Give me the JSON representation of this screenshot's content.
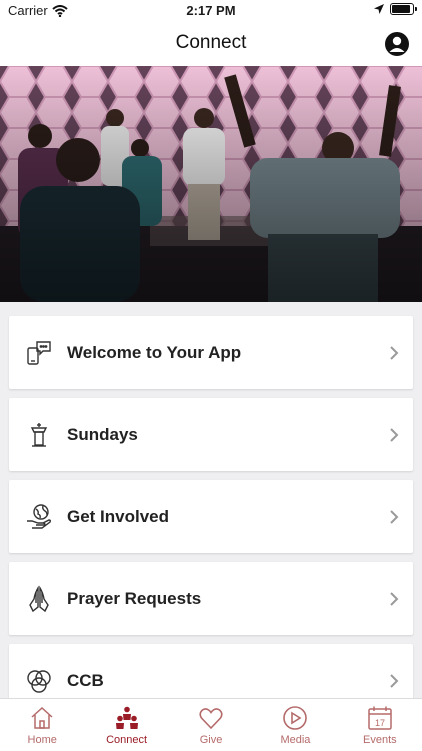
{
  "status_bar": {
    "carrier": "Carrier",
    "time": "2:17 PM"
  },
  "header": {
    "title": "Connect"
  },
  "menu": [
    {
      "label": "Welcome to Your App",
      "icon": "phone-chat-icon"
    },
    {
      "label": "Sundays",
      "icon": "pulpit-icon"
    },
    {
      "label": "Get Involved",
      "icon": "hand-globe-icon"
    },
    {
      "label": "Prayer Requests",
      "icon": "praying-hands-icon"
    },
    {
      "label": "CCB",
      "icon": "overlapping-circles-icon"
    }
  ],
  "tabs": [
    {
      "label": "Home",
      "icon": "home-icon",
      "active": false
    },
    {
      "label": "Connect",
      "icon": "people-icon",
      "active": true
    },
    {
      "label": "Give",
      "icon": "heart-icon",
      "active": false
    },
    {
      "label": "Media",
      "icon": "play-icon",
      "active": false
    },
    {
      "label": "Events",
      "icon": "calendar-icon",
      "active": false
    }
  ],
  "colors": {
    "accent": "#9a1c27",
    "tab_inactive": "#b56a6a",
    "background": "#efeff1"
  }
}
